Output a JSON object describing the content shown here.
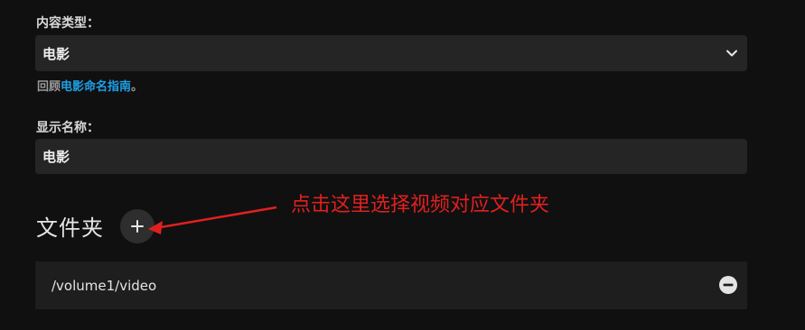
{
  "content_type": {
    "label": "内容类型：",
    "selected": "电影",
    "icon": "chevron-down-icon"
  },
  "hint": {
    "prefix": "回顾",
    "link": "电影命名指南",
    "suffix": "。"
  },
  "display_name": {
    "label": "显示名称：",
    "value": "电影"
  },
  "folders": {
    "title": "文件夹",
    "add_icon": "plus-icon",
    "items": [
      {
        "path": "/volume1/video",
        "remove_icon": "minus-circle-icon"
      }
    ]
  },
  "annotation": {
    "text": "点击这里选择视频对应文件夹",
    "color": "#e02020"
  },
  "colors": {
    "background": "#101010",
    "field_bg": "#252525",
    "link": "#1ea0e6"
  }
}
